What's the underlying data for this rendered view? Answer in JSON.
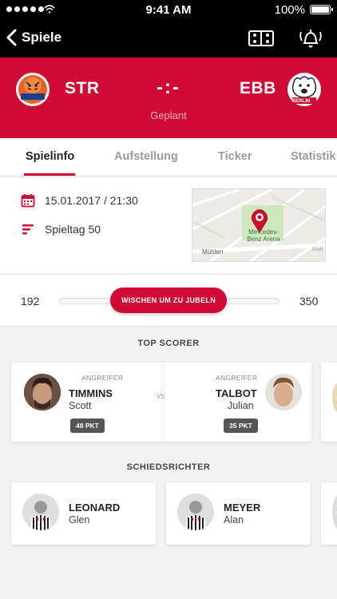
{
  "status_bar": {
    "time": "9:41 AM",
    "battery": "100%"
  },
  "nav": {
    "back_label": "Spiele",
    "field_icon": "field-icon",
    "alarm_icon": "bell-ringing-icon"
  },
  "match": {
    "home_abbr": "STR",
    "away_abbr": "EBB",
    "score": "-:-",
    "state": "Geplant",
    "away_logo_text": "BERLIN",
    "home_logo_text": "TIGERS"
  },
  "tabs": [
    "Spielinfo",
    "Aufstellung",
    "Ticker",
    "Statistik"
  ],
  "info": {
    "datetime": "15.01.2017 / 21:30",
    "matchday": "Spieltag 50",
    "map_label_1": "Mercedes-",
    "map_label_2": "Benz Arena",
    "map_street": "Mühlen",
    "map_street_2": "Matt"
  },
  "jubel": {
    "left_count": "192",
    "right_count": "350",
    "button_label": "WISCHEN UM ZU JUBELN"
  },
  "top_scorer": {
    "title": "TOP SCORER",
    "vs": "VS",
    "home": {
      "position": "ANGREIFER",
      "last_name": "TIMMINS",
      "first_name": "Scott",
      "points": "48 PKT"
    },
    "away": {
      "position": "ANGREIFER",
      "last_name": "TALBOT",
      "first_name": "Julian",
      "points": "35 PKT"
    }
  },
  "referees": {
    "title": "SCHIEDSRICHTER",
    "items": [
      {
        "last_name": "LEONARD",
        "first_name": "Glen"
      },
      {
        "last_name": "MEYER",
        "first_name": "Alan"
      }
    ]
  },
  "colors": {
    "accent": "#d10a33",
    "header_bg": "#d10a33",
    "nav_bg": "#000000",
    "badge": "#555555"
  }
}
